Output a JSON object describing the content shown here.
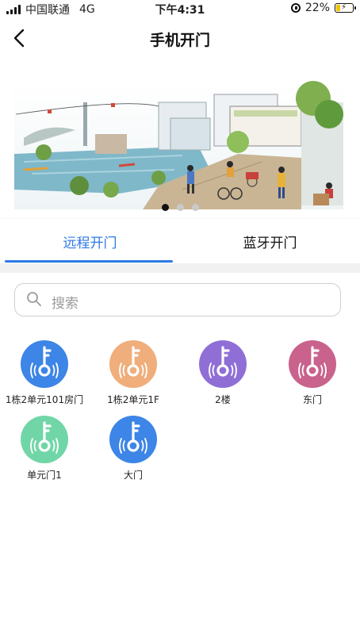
{
  "statusbar": {
    "carrier": "中国联通",
    "network": "4G",
    "time": "下午4:31",
    "battery": "22%",
    "battery_level": 0.22
  },
  "header": {
    "title": "手机开门"
  },
  "banner": {
    "slides": 3,
    "active_index": 0
  },
  "tabs": [
    {
      "label": "远程开门",
      "active": true
    },
    {
      "label": "蓝牙开门",
      "active": false
    }
  ],
  "search": {
    "placeholder": "搜索"
  },
  "doors": [
    {
      "label": "1栋2单元101房门",
      "color": "#3d85e6"
    },
    {
      "label": "1栋2单元1F",
      "color": "#efae7c"
    },
    {
      "label": "2楼",
      "color": "#8f6fd6"
    },
    {
      "label": "东门",
      "color": "#c9628c"
    },
    {
      "label": "单元门1",
      "color": "#71d6a7"
    },
    {
      "label": "大门",
      "color": "#3d85e6"
    }
  ],
  "colors": {
    "accent": "#2d79e6"
  }
}
